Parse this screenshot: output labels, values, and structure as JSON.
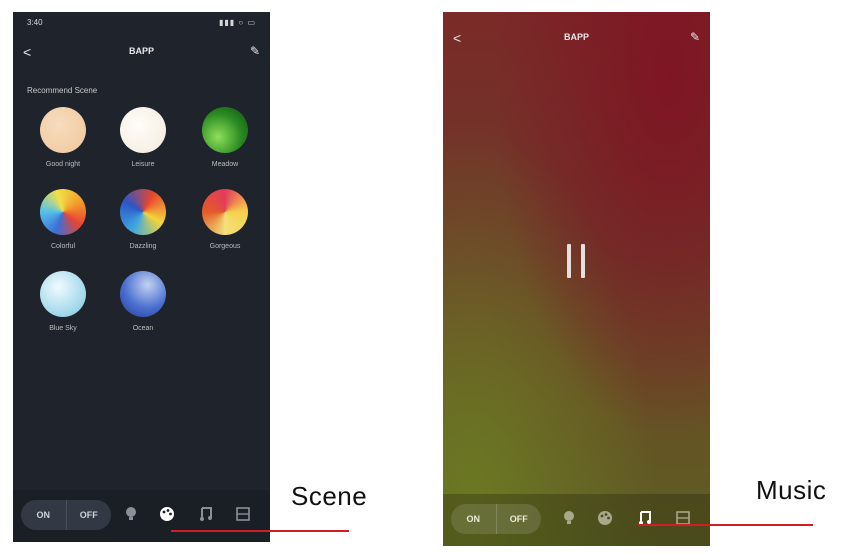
{
  "left_phone": {
    "status": {
      "time": "3:40",
      "icons": "▮▮▮ ○ ▭"
    },
    "nav": {
      "back": "<",
      "title": "BAPP",
      "edit": "✎"
    },
    "section_label": "Recommend Scene",
    "scenes": [
      {
        "label": "Good night",
        "colors": [
          "#f0c9a0",
          "#f5d4b2"
        ]
      },
      {
        "label": "Leisure",
        "colors": [
          "#fdf8ef",
          "#f7efe2"
        ]
      },
      {
        "label": "Meadow",
        "colors": [
          "#1f6b1c",
          "#7fd04a"
        ]
      },
      {
        "label": "Colorful",
        "colors": [
          "#f2c22a",
          "#e64535",
          "#3b6fd8",
          "#56c2e8"
        ]
      },
      {
        "label": "Dazzling",
        "colors": [
          "#e8462e",
          "#f4d53b",
          "#3ea7e0",
          "#2d55c7"
        ]
      },
      {
        "label": "Gorgeous",
        "colors": [
          "#f6d24a",
          "#e35a2a",
          "#e33b5a",
          "#f3e07a"
        ]
      },
      {
        "label": "Blue Sky",
        "colors": [
          "#dff2f7",
          "#9fd6ea",
          "#6bbde0"
        ]
      },
      {
        "label": "Ocean",
        "colors": [
          "#a9bde8",
          "#3a5ec6",
          "#2a3f9a"
        ]
      }
    ],
    "bottom": {
      "on": "ON",
      "off": "OFF"
    }
  },
  "right_phone": {
    "nav": {
      "back": "<",
      "title": "BAPP",
      "edit": "✎"
    },
    "bottom": {
      "on": "ON",
      "off": "OFF"
    }
  },
  "annotations": {
    "scene": "Scene",
    "music": "Music",
    "line_color": "#d31d24"
  }
}
